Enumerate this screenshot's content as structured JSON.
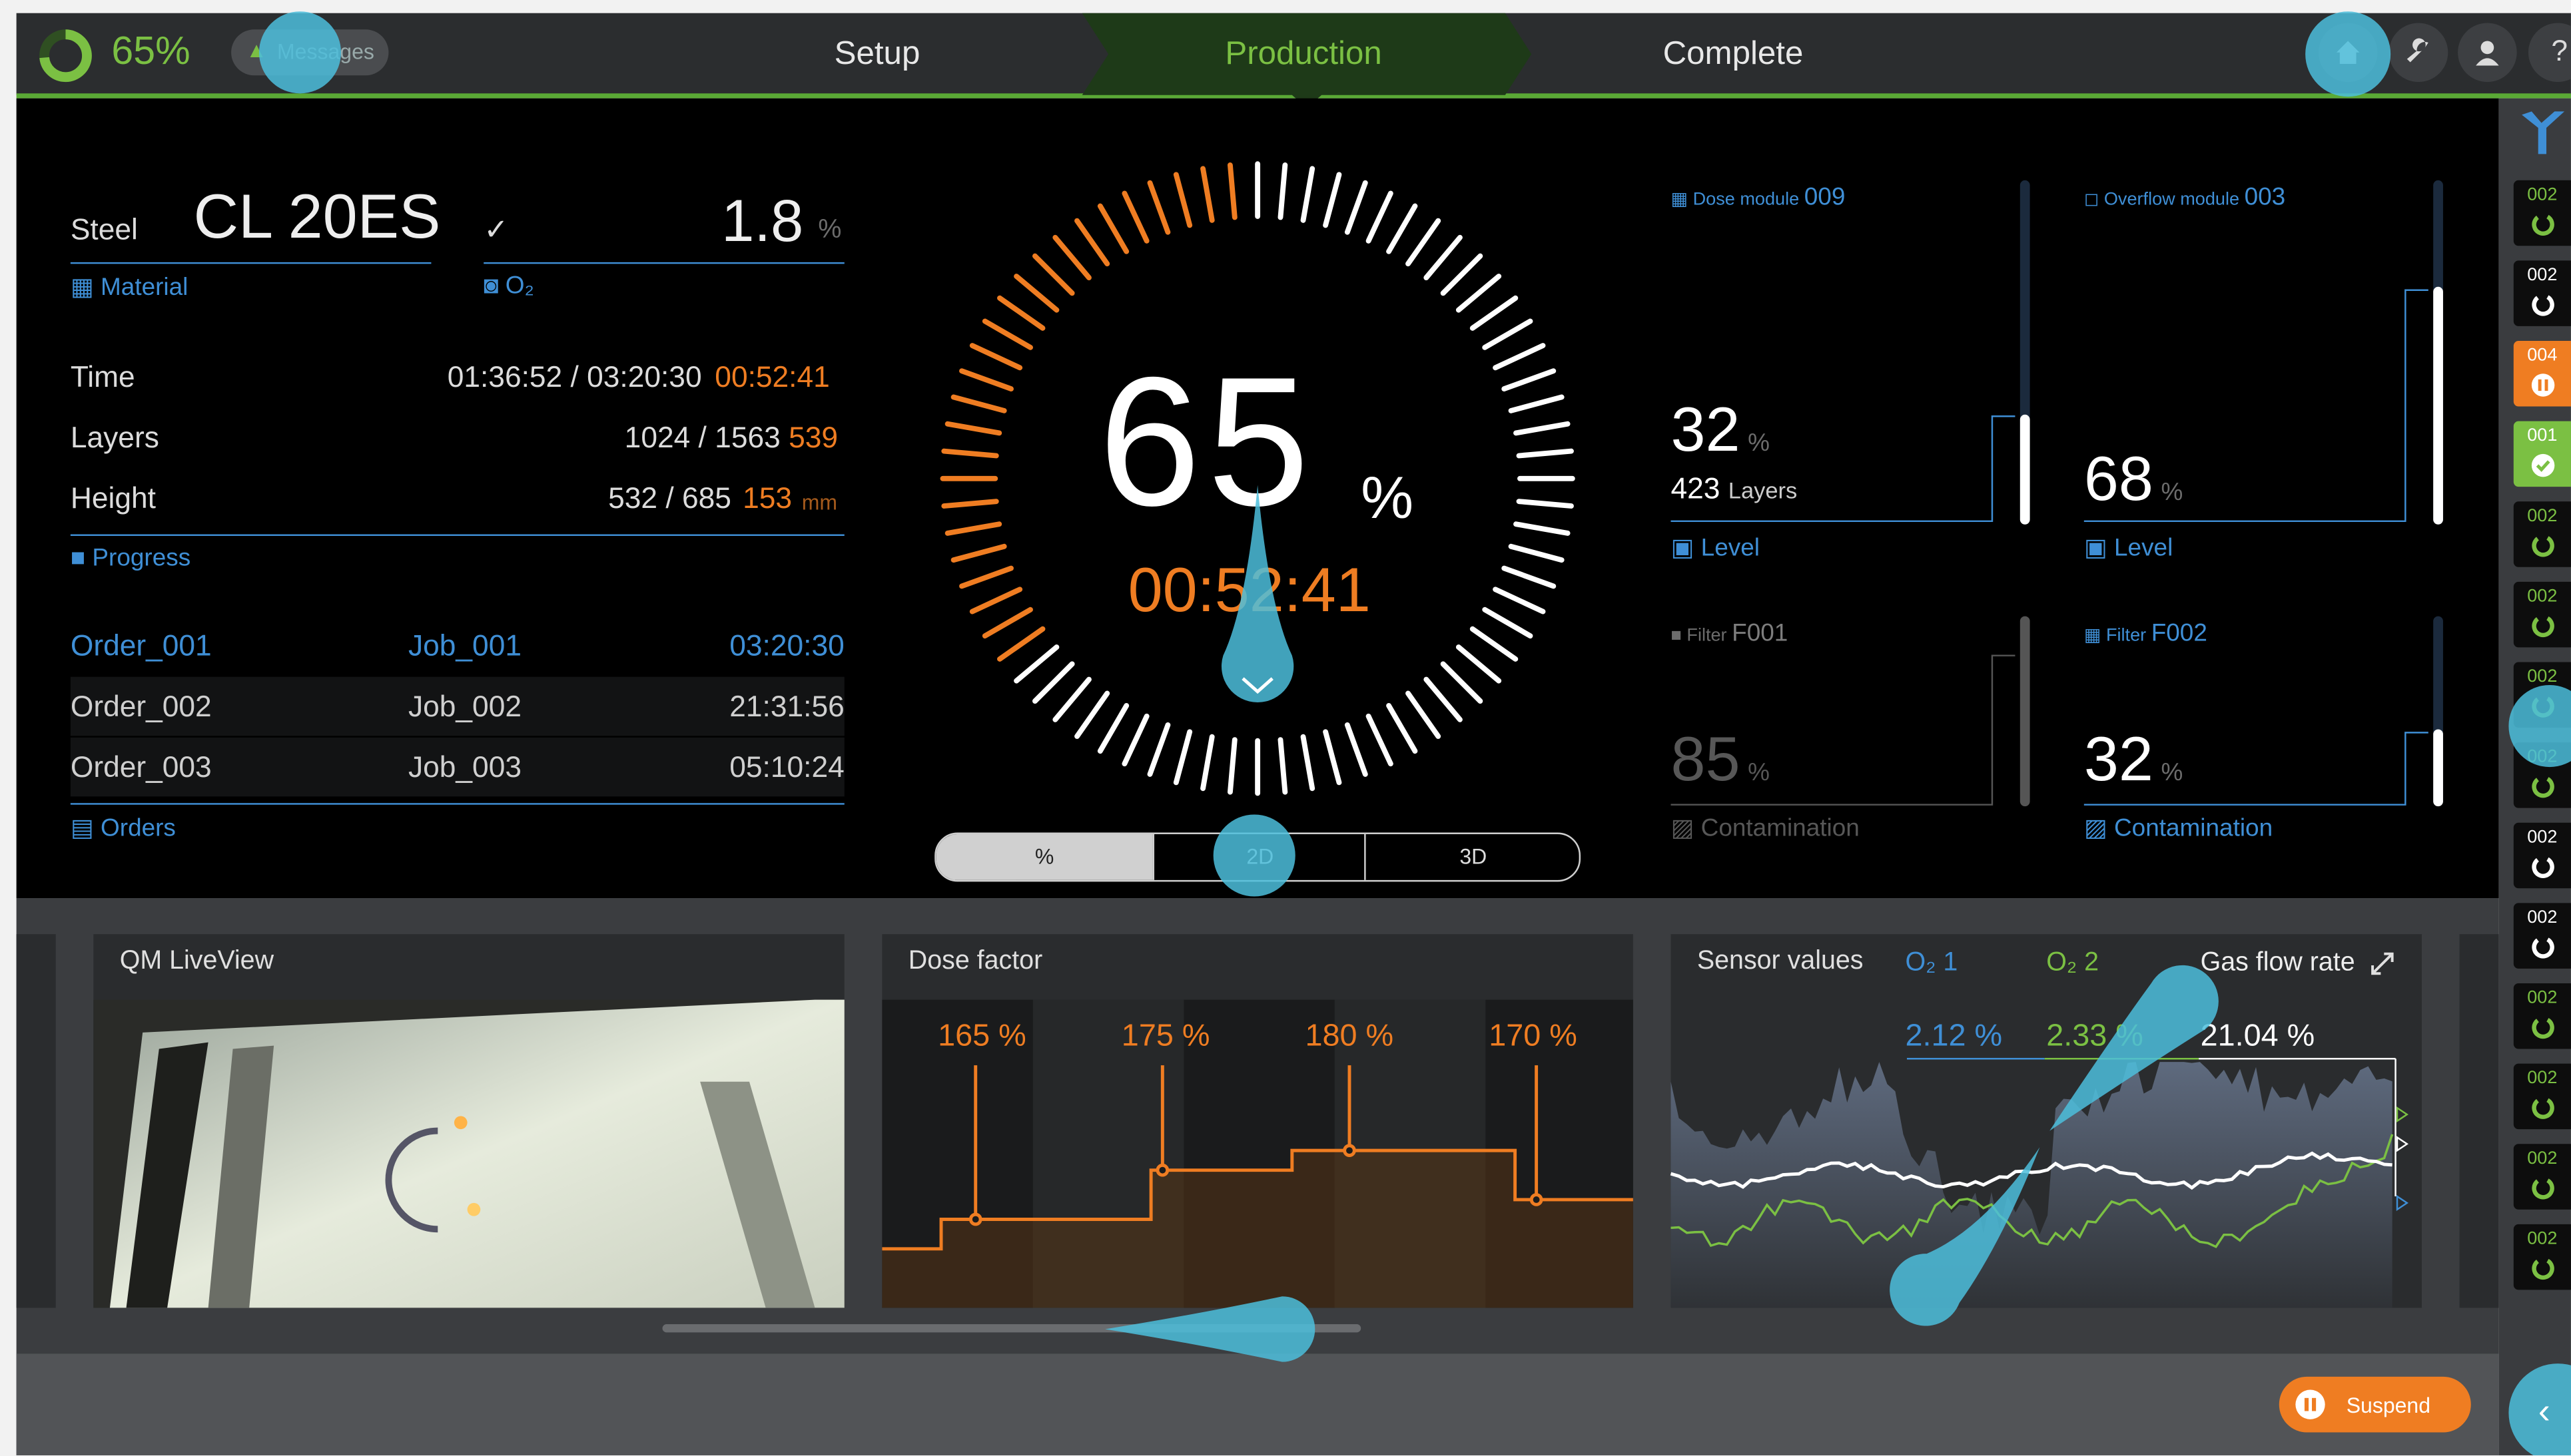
{
  "colors": {
    "accent_green": "#7bc043",
    "accent_orange": "#ef7d22",
    "accent_blue": "#3f8fd6",
    "touch_hint": "#4cbedc"
  },
  "topbar": {
    "progress_text": "65%",
    "progress_icon": "progress-ring-icon",
    "messages_label": "Messages",
    "steps": [
      "Setup",
      "Production",
      "Complete"
    ],
    "active_step": "Production",
    "icons": [
      "home-icon",
      "wrench-icon",
      "user-icon",
      "help-icon"
    ],
    "help_glyph": "?"
  },
  "material": {
    "name_label": "Steel",
    "name_value": "CL 20ES",
    "check_glyph": "✓",
    "o2_value": "1.8",
    "o2_unit": "%",
    "material_label": "Material",
    "o2_label": "O₂"
  },
  "progress": {
    "time": {
      "label": "Time",
      "value": "01:36:52 / 03:20:30",
      "remaining": "00:52:41"
    },
    "layers": {
      "label": "Layers",
      "value": "1024 / 1563",
      "remaining": "539"
    },
    "height": {
      "label": "Height",
      "value": "532 / 685",
      "remaining": "153",
      "unit": "mm"
    },
    "section_label": "Progress"
  },
  "orders": {
    "rows": [
      {
        "order": "Order_001",
        "job": "Job_001",
        "time": "03:20:30",
        "active": true
      },
      {
        "order": "Order_002",
        "job": "Job_002",
        "time": "21:31:56",
        "active": false
      },
      {
        "order": "Order_003",
        "job": "Job_003",
        "time": "05:10:24",
        "active": false
      }
    ],
    "section_label": "Orders"
  },
  "gauge": {
    "percent": "65",
    "percent_sign": "%",
    "remaining": "00:52:41",
    "fraction": 0.65,
    "view_tabs": [
      "%",
      "2D",
      "3D"
    ],
    "active_tab": "%"
  },
  "modules": {
    "dose": {
      "label": "Dose module",
      "id": "009",
      "value": "32",
      "unit": "%",
      "layers": "423",
      "layers_label": "Layers",
      "level_label": "Level",
      "fraction": 0.32
    },
    "overflow": {
      "label": "Overflow module",
      "id": "003",
      "value": "68",
      "unit": "%",
      "level_label": "Level",
      "fraction": 0.68
    },
    "filter1": {
      "label": "Filter",
      "id": "F001",
      "value": "85",
      "unit": "%",
      "status_label": "Contamination",
      "fraction": 0.85
    },
    "filter2": {
      "label": "Filter",
      "id": "F002",
      "value": "32",
      "unit": "%",
      "status_label": "Contamination",
      "fraction": 0.32
    }
  },
  "queue": {
    "items": [
      {
        "num": "002",
        "state": "pending"
      },
      {
        "num": "002",
        "state": "waiting"
      },
      {
        "num": "004",
        "state": "paused"
      },
      {
        "num": "001",
        "state": "done"
      },
      {
        "num": "002",
        "state": "pending"
      },
      {
        "num": "002",
        "state": "pending"
      },
      {
        "num": "002",
        "state": "pending"
      },
      {
        "num": "002",
        "state": "pending"
      },
      {
        "num": "002",
        "state": "waiting"
      },
      {
        "num": "002",
        "state": "waiting"
      },
      {
        "num": "002",
        "state": "pending"
      },
      {
        "num": "002",
        "state": "pending"
      },
      {
        "num": "002",
        "state": "pending"
      },
      {
        "num": "002",
        "state": "pending"
      }
    ]
  },
  "qm": {
    "title": "QM LiveView"
  },
  "dose_factor": {
    "title": "Dose factor",
    "labels": [
      "165 %",
      "175 %",
      "180 %",
      "170 %"
    ]
  },
  "sensors": {
    "title": "Sensor values",
    "series": [
      {
        "name": "O₂ 1",
        "value": "2.12 %",
        "color": "#3f8fd6"
      },
      {
        "name": "O₂ 2",
        "value": "2.33 %",
        "color": "#7bc043"
      },
      {
        "name": "Gas flow rate",
        "value": "21.04 %",
        "color": "#ffffff"
      }
    ],
    "expand_icon": "expand-icon"
  },
  "actions": {
    "suspend_label": "Suspend"
  }
}
